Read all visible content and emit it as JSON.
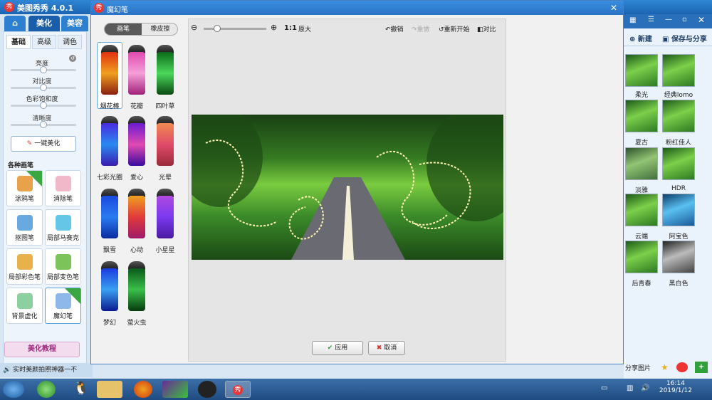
{
  "app": {
    "title": "美图秀秀 4.0.1",
    "logo": "秀"
  },
  "main_tabs": [
    "美化",
    "美容"
  ],
  "left": {
    "subtabs": [
      "基础",
      "高级",
      "调色"
    ],
    "sliders": [
      {
        "label": "亮度",
        "value": 0.5
      },
      {
        "label": "对比度",
        "value": 0.5
      },
      {
        "label": "色彩饱和度",
        "value": 0.5
      },
      {
        "label": "清晰度",
        "value": 0.5
      }
    ],
    "onekey_label": "一键美化",
    "brushes_heading": "各种画笔",
    "brushes": [
      {
        "label": "涂鸦笔",
        "badge": "升级"
      },
      {
        "label": "消除笔",
        "badge": ""
      },
      {
        "label": "抠图笔",
        "badge": ""
      },
      {
        "label": "局部马赛克",
        "badge": ""
      },
      {
        "label": "局部彩色笔",
        "badge": ""
      },
      {
        "label": "局部变色笔",
        "badge": ""
      },
      {
        "label": "背景虚化",
        "badge": ""
      },
      {
        "label": "魔幻笔",
        "badge": "new"
      }
    ],
    "tutorial_label": "美化教程",
    "status": "实时美颜拍照神器一不"
  },
  "right": {
    "new_label": "新建",
    "save_label": "保存与分享",
    "effects": [
      "柔光",
      "经典lomo",
      "夏古",
      "粉红佳人",
      "淡雅",
      "HDR",
      "云端",
      "阿宝色",
      "后青春",
      "黑白色"
    ],
    "share_label": "分享图片"
  },
  "dialog": {
    "title": "魔幻笔",
    "modes": [
      "画笔",
      "橡皮擦"
    ],
    "pens": [
      "烟花棒",
      "花瓣",
      "四叶草",
      "七彩光圈",
      "爱心",
      "光晕",
      "飘雪",
      "心动",
      "小星星",
      "梦幻",
      "萤火虫"
    ],
    "zoom_ratio": "1:1",
    "original_label": "原大",
    "undo_label": "撤销",
    "redo_label": "重做",
    "restart_label": "重新开始",
    "compare_label": "对比",
    "apply_label": "应用",
    "cancel_label": "取消"
  },
  "taskbar": {
    "time": "16:14",
    "date": "2019/1/12"
  },
  "colors": {
    "accent": "#1a64b2",
    "title_bar": "#2a73c5",
    "apply_icon": "#2f9e3a",
    "cancel_icon": "#d93030"
  }
}
